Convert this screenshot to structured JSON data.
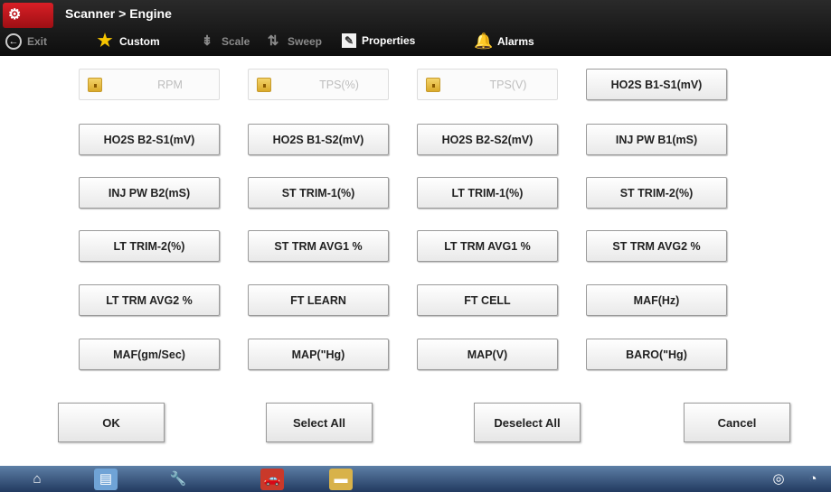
{
  "title": {
    "breadcrumb": "Scanner > Engine"
  },
  "toolbar": {
    "exit": "Exit",
    "custom": "Custom",
    "scale": "Scale",
    "sweep": "Sweep",
    "properties": "Properties",
    "alarms": "Alarms"
  },
  "pids": [
    {
      "label": "RPM",
      "locked": true
    },
    {
      "label": "TPS(%)",
      "locked": true
    },
    {
      "label": "TPS(V)",
      "locked": true
    },
    {
      "label": "HO2S B1-S1(mV)",
      "locked": false
    },
    {
      "label": "HO2S B2-S1(mV)",
      "locked": false
    },
    {
      "label": "HO2S B1-S2(mV)",
      "locked": false
    },
    {
      "label": "HO2S B2-S2(mV)",
      "locked": false
    },
    {
      "label": "INJ PW B1(mS)",
      "locked": false
    },
    {
      "label": "INJ PW B2(mS)",
      "locked": false
    },
    {
      "label": "ST TRIM-1(%)",
      "locked": false
    },
    {
      "label": "LT TRIM-1(%)",
      "locked": false
    },
    {
      "label": "ST TRIM-2(%)",
      "locked": false
    },
    {
      "label": "LT TRIM-2(%)",
      "locked": false
    },
    {
      "label": "ST TRM AVG1 %",
      "locked": false
    },
    {
      "label": "LT TRM AVG1 %",
      "locked": false
    },
    {
      "label": "ST TRM AVG2 %",
      "locked": false
    },
    {
      "label": "LT TRM AVG2 %",
      "locked": false
    },
    {
      "label": "FT LEARN",
      "locked": false
    },
    {
      "label": "FT CELL",
      "locked": false
    },
    {
      "label": "MAF(Hz)",
      "locked": false
    },
    {
      "label": "MAF(gm/Sec)",
      "locked": false
    },
    {
      "label": "MAP(\"Hg)",
      "locked": false
    },
    {
      "label": "MAP(V)",
      "locked": false
    },
    {
      "label": "BARO(\"Hg)",
      "locked": false
    }
  ],
  "actions": {
    "ok": "OK",
    "select_all": "Select All",
    "deselect_all": "Deselect All",
    "cancel": "Cancel"
  },
  "colors": {
    "title_bar": "#111111",
    "logo": "#c8161d",
    "taskbar": "#2e4b75",
    "lock_icon": "#e5b93b"
  },
  "icons": {
    "exit": "arrow-left-icon",
    "custom": "star-icon",
    "scale": "scale-icon",
    "sweep": "sweep-icon",
    "properties": "edit-icon",
    "alarms": "bell-icon",
    "locked_pid": "lock-icon"
  }
}
